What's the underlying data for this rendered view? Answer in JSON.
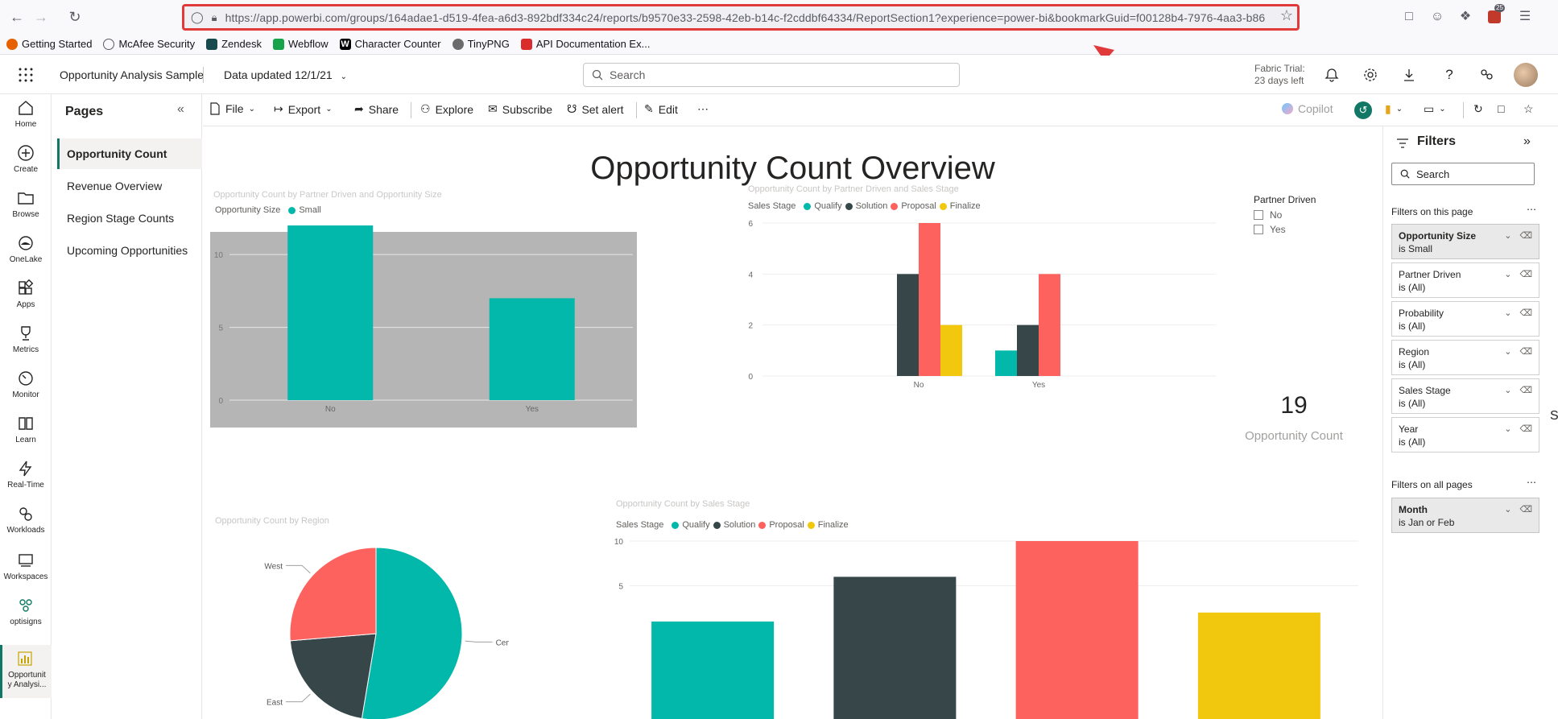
{
  "browser": {
    "url": "https://app.powerbi.com/groups/164adae1-d519-4fea-a6d3-892bdf334c24/reports/b9570e33-2598-42eb-b14c-f2cddbf64334/ReportSection1?experience=power-bi&bookmarkGuid=f00128b4-7976-4aa3-b86",
    "extension_badge": "25",
    "bookmarks": [
      {
        "label": "Getting Started",
        "color": "#e66000"
      },
      {
        "label": "McAfee Security",
        "color": "#5b5b66"
      },
      {
        "label": "Zendesk",
        "color": "#17494d"
      },
      {
        "label": "Webflow",
        "color": "#146ef5"
      },
      {
        "label": "Character Counter",
        "color": "#000000"
      },
      {
        "label": "TinyPNG",
        "color": "#6b6b6b"
      },
      {
        "label": "API Documentation Ex...",
        "color": "#d92c2c"
      }
    ]
  },
  "header": {
    "report_title": "Opportunity Analysis Sample",
    "data_updated": "Data updated 12/1/21",
    "search_placeholder": "Search",
    "trial_line1": "Fabric Trial:",
    "trial_line2": "23 days left"
  },
  "rail": {
    "items": [
      {
        "label": "Home"
      },
      {
        "label": "Create"
      },
      {
        "label": "Browse"
      },
      {
        "label": "OneLake"
      },
      {
        "label": "Apps"
      },
      {
        "label": "Metrics"
      },
      {
        "label": "Monitor"
      },
      {
        "label": "Learn"
      },
      {
        "label": "Real-Time"
      },
      {
        "label": "Workloads"
      },
      {
        "label": "Workspaces"
      },
      {
        "label": "optisigns"
      },
      {
        "label": "Opportunit y Analysi..."
      }
    ]
  },
  "pages": {
    "title": "Pages",
    "items": [
      {
        "label": "Opportunity Count"
      },
      {
        "label": "Revenue Overview"
      },
      {
        "label": "Region Stage Counts"
      },
      {
        "label": "Upcoming Opportunities"
      }
    ]
  },
  "toolbar": {
    "file": "File",
    "export": "Export",
    "share": "Share",
    "explore": "Explore",
    "subscribe": "Subscribe",
    "set_alert": "Set alert",
    "edit": "Edit",
    "more": "⋯",
    "copilot": "Copilot"
  },
  "report": {
    "heading": "Opportunity Count Overview",
    "slicer": {
      "title": "Partner Driven",
      "options": [
        "No",
        "Yes"
      ]
    },
    "card": {
      "value": "19",
      "label": "Opportunity Count"
    }
  },
  "colors": {
    "qualify": "#01b8aa",
    "solution": "#374649",
    "proposal": "#fd625e",
    "finalize": "#f2c80f",
    "accent": "#117865"
  },
  "chart_data": [
    {
      "type": "bar",
      "title": "Opportunity Count by Partner Driven and Opportunity Size",
      "legend_title": "Opportunity Size",
      "categories": [
        "No",
        "Yes"
      ],
      "series": [
        {
          "name": "Small",
          "values": [
            12,
            7
          ]
        }
      ],
      "ylim": [
        0,
        12
      ],
      "yticks": [
        0,
        5,
        10
      ],
      "selected": true
    },
    {
      "type": "bar",
      "title": "Opportunity Count by Partner Driven and Sales Stage",
      "legend_title": "Sales Stage",
      "categories": [
        "No",
        "Yes"
      ],
      "series": [
        {
          "name": "Qualify",
          "values": [
            0,
            1
          ]
        },
        {
          "name": "Solution",
          "values": [
            4,
            2
          ]
        },
        {
          "name": "Proposal",
          "values": [
            6,
            4
          ]
        },
        {
          "name": "Finalize",
          "values": [
            2,
            0
          ]
        }
      ],
      "ylim": [
        0,
        6
      ],
      "yticks": [
        0,
        2,
        4,
        6
      ]
    },
    {
      "type": "pie",
      "title": "Opportunity Count by Region",
      "slices": [
        {
          "label": "Central",
          "value": 10
        },
        {
          "label": "East",
          "value": 4
        },
        {
          "label": "West",
          "value": 5
        }
      ]
    },
    {
      "type": "bar",
      "title": "Opportunity Count by Sales Stage",
      "legend_title": "Sales Stage",
      "categories": [
        "Qualify",
        "Solution",
        "Proposal",
        "Finalize"
      ],
      "values": [
        1,
        6,
        10,
        2
      ],
      "ylim": [
        0,
        10
      ],
      "yticks": [
        5,
        10
      ]
    }
  ],
  "filters": {
    "title": "Filters",
    "search_placeholder": "Search",
    "on_this_page_label": "Filters on this page",
    "on_all_pages_label": "Filters on all pages",
    "page_filters": [
      {
        "name": "Opportunity Size",
        "state": "is Small",
        "applied": true
      },
      {
        "name": "Partner Driven",
        "state": "is (All)",
        "applied": false
      },
      {
        "name": "Probability",
        "state": "is (All)",
        "applied": false
      },
      {
        "name": "Region",
        "state": "is (All)",
        "applied": false
      },
      {
        "name": "Sales Stage",
        "state": "is (All)",
        "applied": false
      },
      {
        "name": "Year",
        "state": "is (All)",
        "applied": false
      }
    ],
    "all_filters": [
      {
        "name": "Month",
        "state": "is Jan or Feb",
        "applied": true
      }
    ]
  }
}
